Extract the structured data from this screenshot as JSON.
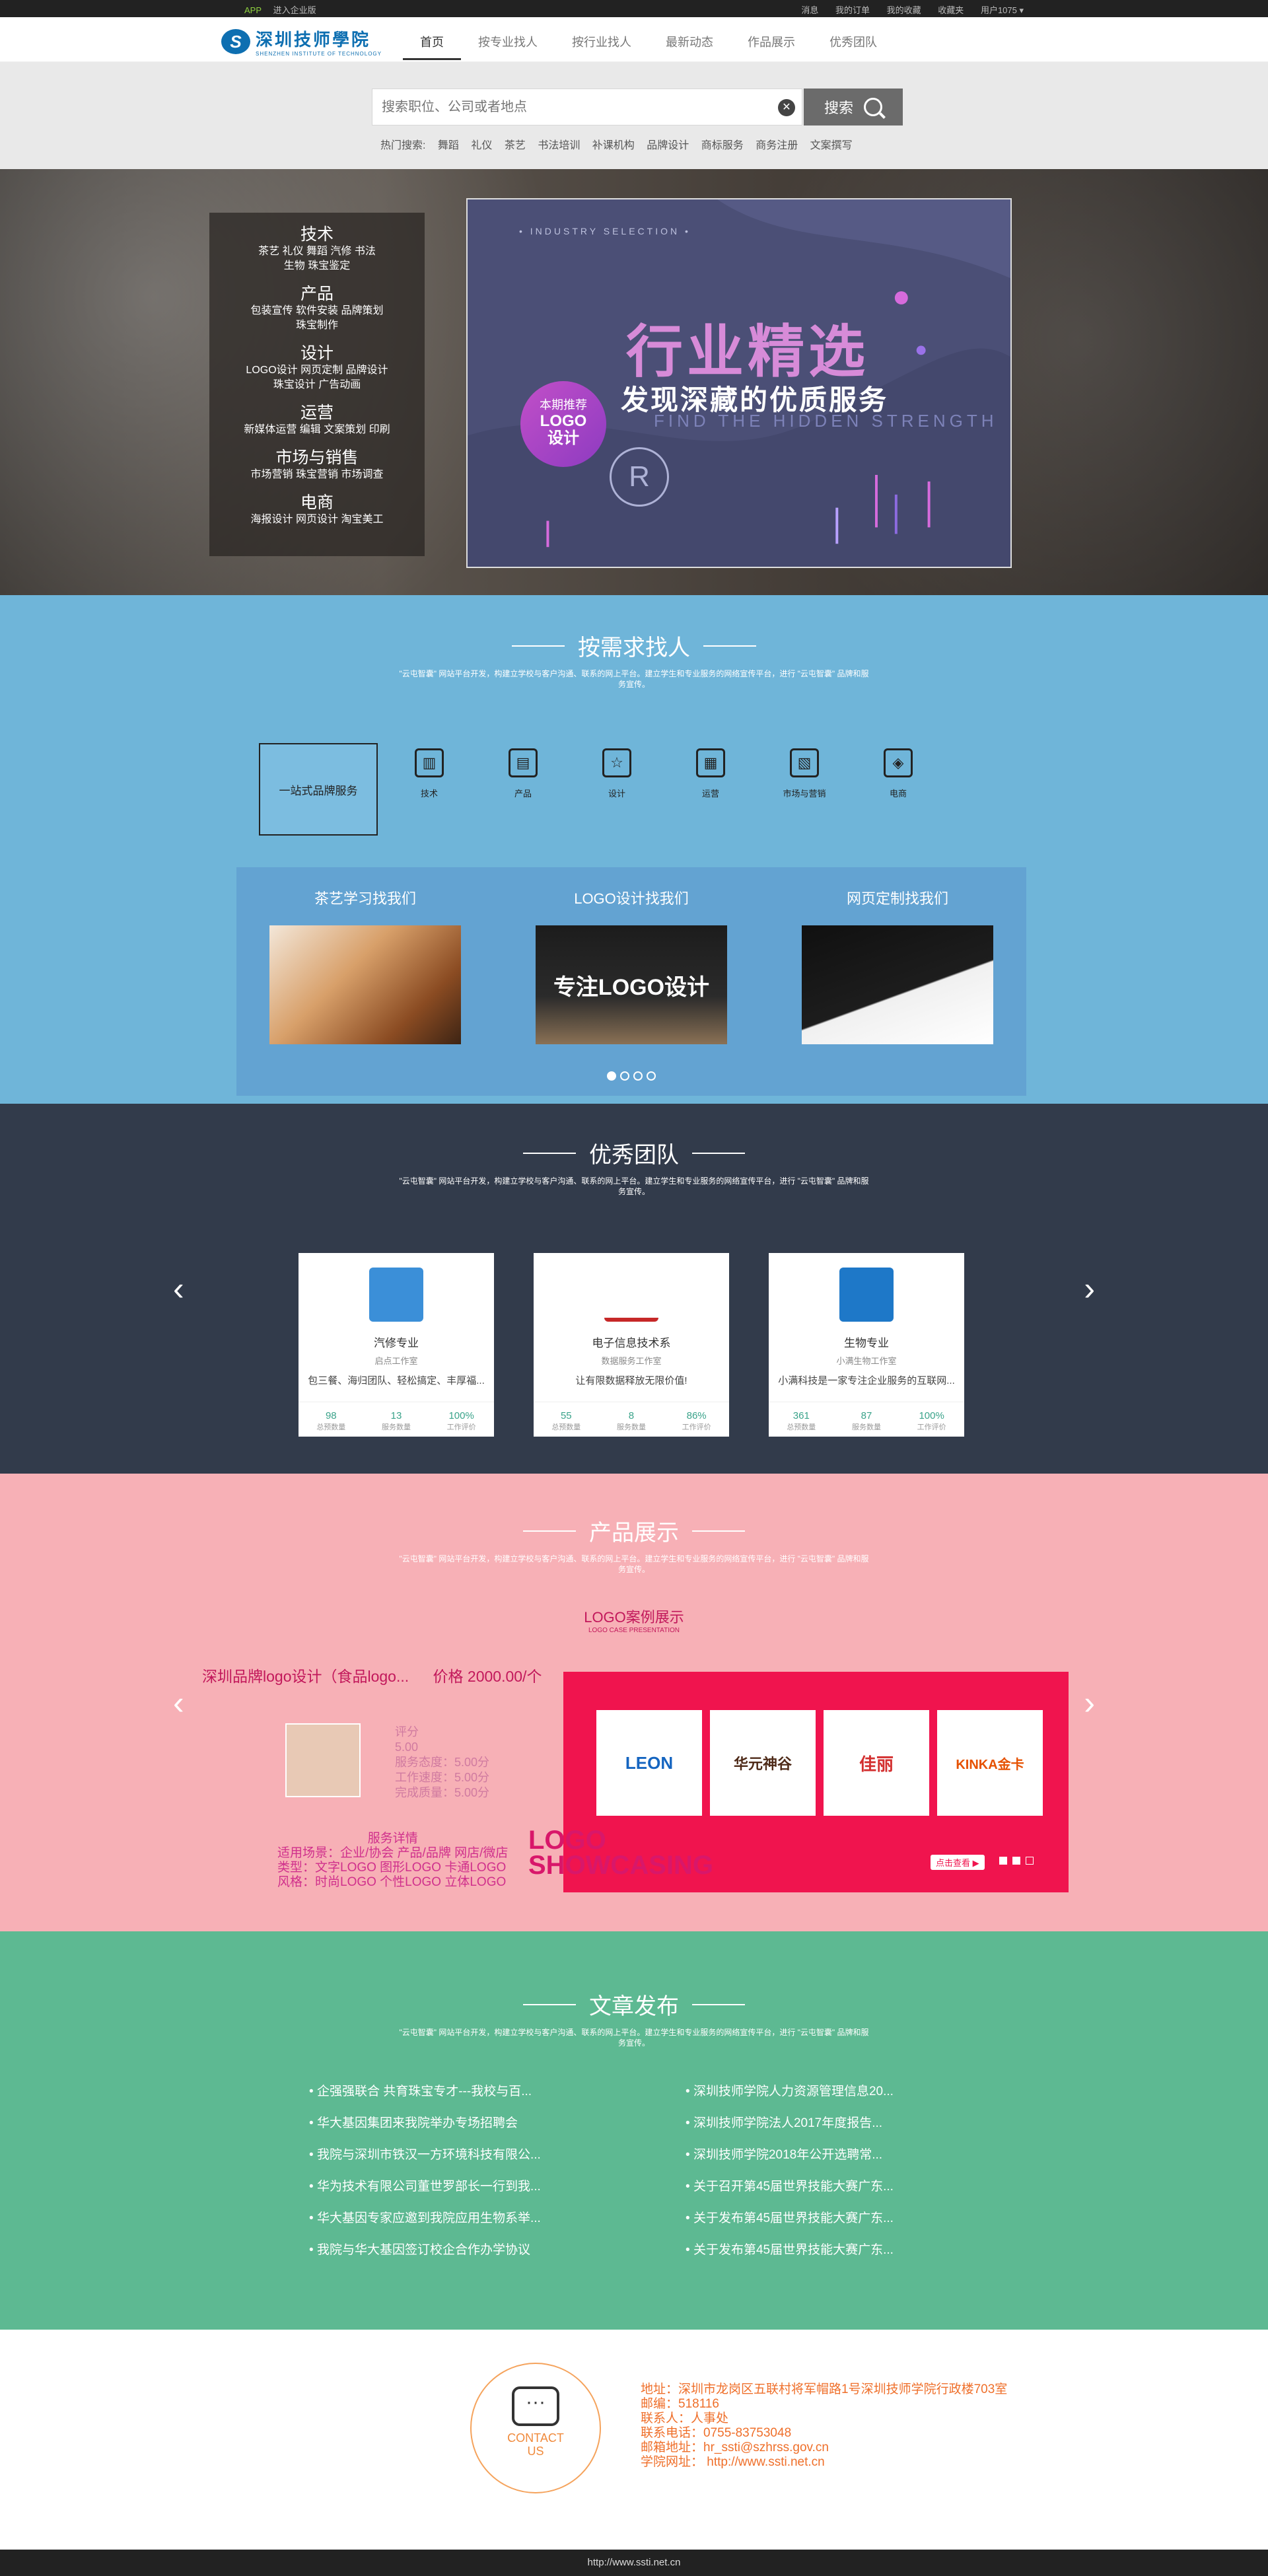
{
  "topbar": {
    "app": "APP",
    "enterprise": "进入企业版",
    "links": [
      "消息",
      "我的订单",
      "我的收藏",
      "收藏夹",
      "用户1075 ▾"
    ]
  },
  "nav": {
    "logo_cn": "深圳技师學院",
    "logo_en": "SHENZHEN INSTITUTE OF TECHNOLOGY",
    "menu": [
      "首页",
      "按专业找人",
      "按行业找人",
      "最新动态",
      "作品展示",
      "优秀团队"
    ]
  },
  "search": {
    "placeholder": "搜索职位、公司或者地点",
    "button": "搜索",
    "hot_label": "热门搜索:",
    "hot": [
      "舞蹈",
      "礼仪",
      "茶艺",
      "书法培训",
      "补课机构",
      "品牌设计",
      "商标服务",
      "商务注册",
      "文案撰写"
    ]
  },
  "hero": {
    "categories": [
      {
        "title": "技术",
        "lines": [
          "茶艺  礼仪  舞蹈  汽修  书法",
          "生物  珠宝鉴定"
        ]
      },
      {
        "title": "产品",
        "lines": [
          "包装宣传  软件安装  品牌策划",
          "珠宝制作"
        ]
      },
      {
        "title": "设计",
        "lines": [
          "LOGO设计  网页定制  品牌设计",
          "珠宝设计  广告动画"
        ]
      },
      {
        "title": "运营",
        "lines": [
          "新媒体运营  编辑  文案策划  印刷"
        ]
      },
      {
        "title": "市场与销售",
        "lines": [
          "市场营销  珠宝营销  市场调查"
        ]
      },
      {
        "title": "电商",
        "lines": [
          "海报设计  网页设计  淘宝美工"
        ]
      }
    ],
    "banner": {
      "industry": "• INDUSTRY SELECTION •",
      "title": "行业精选",
      "subtitle": "发现深藏的优质服务",
      "en": "FIND THE HIDDEN STRENGTH",
      "circle_top": "本期推荐",
      "circle_l1": "LOGO",
      "circle_l2": "设计",
      "r": "R"
    }
  },
  "section1": {
    "title": "按需求找人",
    "desc": "\"云屯智囊\" 网站平台开发，构建立学校与客户沟通、联系的网上平台。建立学生和专业服务的网络宣传平台，进行 \"云屯智囊\" 品牌和服务宣传。",
    "first": "一站式品牌服务",
    "items": [
      {
        "label": "技术",
        "icon": "▥"
      },
      {
        "label": "产品",
        "icon": "▤"
      },
      {
        "label": "设计",
        "icon": "☆"
      },
      {
        "label": "运营",
        "icon": "▦"
      },
      {
        "label": "市场与营销",
        "icon": "▧"
      },
      {
        "label": "电商",
        "icon": "◈"
      }
    ],
    "cases": [
      "茶艺学习找我们",
      "LOGO设计找我们",
      "网页定制找我们"
    ],
    "case2_text": "专注LOGO设计"
  },
  "section2": {
    "title": "优秀团队",
    "desc": "\"云屯智囊\" 网站平台开发，构建立学校与客户沟通、联系的网上平台。建立学生和专业服务的网络宣传平台，进行 \"云屯智囊\" 品牌和服务宣传。",
    "teams": [
      {
        "name": "汽修专业",
        "sub": "启点工作室",
        "desc": "包三餐、海归团队、轻松搞定、丰厚福...",
        "stats": [
          [
            "98",
            "总预数量"
          ],
          [
            "13",
            "服务数量"
          ],
          [
            "100%",
            "工作评价"
          ]
        ],
        "color": "#3b8fd8"
      },
      {
        "name": "电子信息技术系",
        "sub": "数据服务工作室",
        "desc": "让有限数据释放无限价值!",
        "stats": [
          [
            "55",
            "总预数量"
          ],
          [
            "8",
            "服务数量"
          ],
          [
            "86%",
            "工作评价"
          ]
        ],
        "color": "#c62828"
      },
      {
        "name": "生物专业",
        "sub": "小满生物工作室",
        "desc": "小满科技是一家专注企业服务的互联网...",
        "stats": [
          [
            "361",
            "总预数量"
          ],
          [
            "87",
            "服务数量"
          ],
          [
            "100%",
            "工作评价"
          ]
        ],
        "color": "#1e78c8"
      }
    ]
  },
  "section3": {
    "title": "产品展示",
    "desc": "\"云屯智囊\" 网站平台开发，构建立学校与客户沟通、联系的网上平台。建立学生和专业服务的网络宣传平台，进行 \"云屯智囊\" 品牌和服务宣传。",
    "case_title": "LOGO案例展示",
    "case_sub": "LOGO CASE PRESENTATION",
    "product": "深圳品牌logo设计（食品logo...",
    "price": "价格  2000.00/个",
    "rating": [
      "评分",
      "5.00",
      "服务态度：5.00分",
      "工作速度：5.00分",
      "完成质量：5.00分"
    ],
    "detail": [
      "服务详情",
      "适用场景：企业/协会 产品/品牌 网店/微店",
      "类型：文字LOGO 图形LOGO 卡通LOGO",
      "风格：时尚LOGO 个性LOGO 立体LOGO"
    ],
    "showcase_l1": "LOGO",
    "showcase_l2": "SHOWCASING",
    "logos": [
      "LEON",
      "华元神谷",
      "佳丽",
      "KINKA金卡"
    ],
    "more": "点击查看 ▶"
  },
  "section4": {
    "title": "文章发布",
    "desc": "\"云屯智囊\" 网站平台开发，构建立学校与客户沟通、联系的网上平台。建立学生和专业服务的网络宣传平台，进行 \"云屯智囊\" 品牌和服务宣传。",
    "news": [
      "企强强联合 共育珠宝专才---我校与百...",
      "深圳技师学院人力资源管理信息20...",
      "华大基因集团来我院举办专场招聘会",
      "深圳技师学院法人2017年度报告...",
      "我院与深圳市铁汉一方环境科技有限公...",
      "深圳技师学院2018年公开选聘常...",
      "华为技术有限公司董世罗部长一行到我...",
      "关于召开第45届世界技能大赛广东...",
      "华大基因专家应邀到我院应用生物系举...",
      "关于发布第45届世界技能大赛广东...",
      "我院与华大基因签订校企合作办学协议",
      "关于发布第45届世界技能大赛广东..."
    ]
  },
  "footer": {
    "contact_l1": "CONTACT",
    "contact_l2": "US",
    "lines": [
      "地址：深圳市龙岗区五联村将军帽路1号深圳技师学院行政楼703室",
      "邮编：518116",
      "联系人：人事处",
      "联系电话：0755-83753048",
      "邮箱地址：hr_ssti@szhrss.gov.cn",
      "学院网址：  http://www.ssti.net.cn"
    ],
    "url": "http://www.ssti.net.cn"
  }
}
